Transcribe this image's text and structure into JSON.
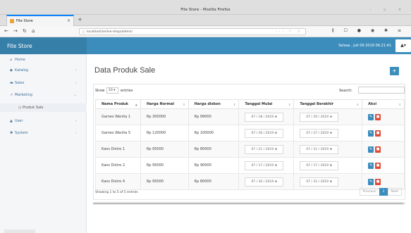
{
  "browser": {
    "window_title": "Fite Store - Mozilla Firefox",
    "tab_title": "Fite Store",
    "url": "localhost/online-shop/admin/"
  },
  "header": {
    "logo": "Fite Store",
    "datetime": "Selasa , Juli 09 2019 06:21:41",
    "user_menu": "▲▾"
  },
  "sidebar": {
    "items": [
      {
        "icon": "home-icon",
        "glyph": "⌂",
        "label": "Home",
        "chevron": ""
      },
      {
        "icon": "tag-icon",
        "glyph": "◆",
        "label": "Katalog",
        "chevron": "‹"
      },
      {
        "icon": "cart-icon",
        "glyph": "▬",
        "label": "Sales",
        "chevron": "‹"
      },
      {
        "icon": "share-icon",
        "glyph": "↗",
        "label": "Marketing",
        "chevron": "⌄"
      },
      {
        "icon": "user-icon",
        "glyph": "▲",
        "label": "User",
        "chevron": "‹"
      },
      {
        "icon": "cogs-icon",
        "glyph": "✱",
        "label": "System",
        "chevron": "‹"
      }
    ],
    "sub_item": "○ Produk Sale"
  },
  "main": {
    "title": "Data Produk Sale",
    "add_button": "+",
    "show_label": "Show",
    "show_value": "10",
    "entries_label": "entries",
    "search_label": "Search:",
    "columns": [
      "Nama Produk",
      "Harga Normal",
      "Harga diskon",
      "Tanggal Mulai",
      "Tanggal Berakhir",
      "Aksi"
    ],
    "rows": [
      {
        "nama": "Games Wanita 1",
        "normal": "Rp 300000",
        "diskon": "Rp 99000",
        "mulai": "07 / 18 / 2019 ⊗",
        "akhir": "07 / 20 / 2019 ⊗"
      },
      {
        "nama": "Games Wanita 5",
        "normal": "Rp 120000",
        "diskon": "Rp 100000",
        "mulai": "07 / 26 / 2019 ⊗",
        "akhir": "07 / 27 / 2019 ⊗"
      },
      {
        "nama": "Kaos Distro 1",
        "normal": "Rp 95000",
        "diskon": "Rp 80000",
        "mulai": "07 / 21 / 2019 ⊗",
        "akhir": "07 / 21 / 2019 ⊗"
      },
      {
        "nama": "Kaos Distro 2",
        "normal": "Rp 95000",
        "diskon": "Rp 90000",
        "mulai": "07 / 17 / 2019 ⊗",
        "akhir": "07 / 17 / 2019 ⊗"
      },
      {
        "nama": "Kaos Distro 4",
        "normal": "Rp 95000",
        "diskon": "Rp 80000",
        "mulai": "07 / 30 / 2019 ⊗",
        "akhir": "07 / 31 / 2019 ⊗"
      }
    ],
    "edit_label": "✎",
    "delete_label": "■",
    "showing_text": "Showing 1 to 5 of 5 entries",
    "pager": {
      "previous": "Previous",
      "current": "1",
      "next": "Next"
    }
  }
}
